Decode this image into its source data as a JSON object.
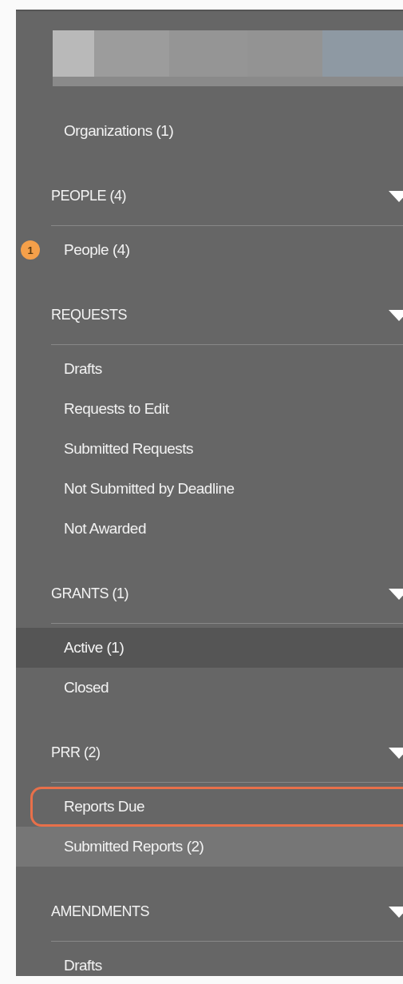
{
  "top_items": [
    {
      "label": "Organizations (1)",
      "selected": false
    }
  ],
  "sections": [
    {
      "title": "PEOPLE (4)",
      "expanded": true,
      "items": [
        {
          "label": "People (4)",
          "badge": "1",
          "selected": false,
          "hovered": false,
          "outlined": false
        }
      ]
    },
    {
      "title": "REQUESTS",
      "expanded": true,
      "items": [
        {
          "label": "Drafts",
          "selected": false,
          "hovered": false,
          "outlined": false
        },
        {
          "label": "Requests to Edit",
          "selected": false,
          "hovered": false,
          "outlined": false
        },
        {
          "label": "Submitted Requests",
          "selected": false,
          "hovered": false,
          "outlined": false
        },
        {
          "label": "Not Submitted by Deadline",
          "selected": false,
          "hovered": false,
          "outlined": false
        },
        {
          "label": "Not Awarded",
          "selected": false,
          "hovered": false,
          "outlined": false
        }
      ]
    },
    {
      "title": "GRANTS (1)",
      "expanded": true,
      "items": [
        {
          "label": "Active (1)",
          "selected": true,
          "hovered": false,
          "outlined": false
        },
        {
          "label": "Closed",
          "selected": false,
          "hovered": false,
          "outlined": false
        }
      ]
    },
    {
      "title": "PRR (2)",
      "expanded": true,
      "items": [
        {
          "label": "Reports Due",
          "selected": false,
          "hovered": false,
          "outlined": true
        },
        {
          "label": "Submitted Reports (2)",
          "selected": false,
          "hovered": true,
          "outlined": false
        }
      ]
    },
    {
      "title": "AMENDMENTS",
      "expanded": true,
      "items": [
        {
          "label": "Drafts",
          "selected": false,
          "hovered": false,
          "outlined": false
        }
      ]
    }
  ]
}
